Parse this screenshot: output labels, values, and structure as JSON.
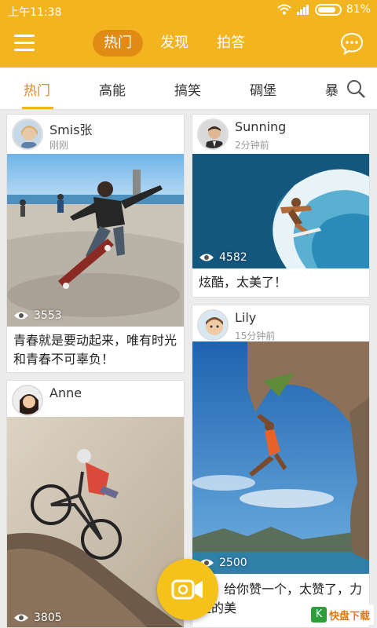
{
  "status_bar": {
    "time": "上午11:38",
    "battery": "81%"
  },
  "top_tabs": [
    {
      "label": "热门",
      "active": true
    },
    {
      "label": "发现",
      "active": false
    },
    {
      "label": "拍答",
      "active": false
    }
  ],
  "sub_tabs": [
    {
      "label": "热门",
      "active": true
    },
    {
      "label": "高能",
      "active": false
    },
    {
      "label": "搞笑",
      "active": false
    },
    {
      "label": "碉堡",
      "active": false
    },
    {
      "label": "暴",
      "active": false
    }
  ],
  "colors": {
    "accent": "#f3b51f",
    "accent_dark": "#e08c14"
  },
  "posts": [
    {
      "author": "Smis张",
      "time": "刚刚",
      "views": "3553",
      "caption": "青春就是要动起来，唯有时光和青春不可辜负！"
    },
    {
      "author": "Sunning",
      "time": "2分钟前",
      "views": "4582",
      "caption": "炫酷，太美了！"
    },
    {
      "author": "Lily",
      "time": "15分钟前",
      "views": "2500",
      "caption": "哥，给你赞一个，太赞了，力量的美"
    },
    {
      "author": "Anne",
      "time": "",
      "views": "3805",
      "caption": ""
    }
  ],
  "watermark": {
    "text": "快盘下载"
  }
}
